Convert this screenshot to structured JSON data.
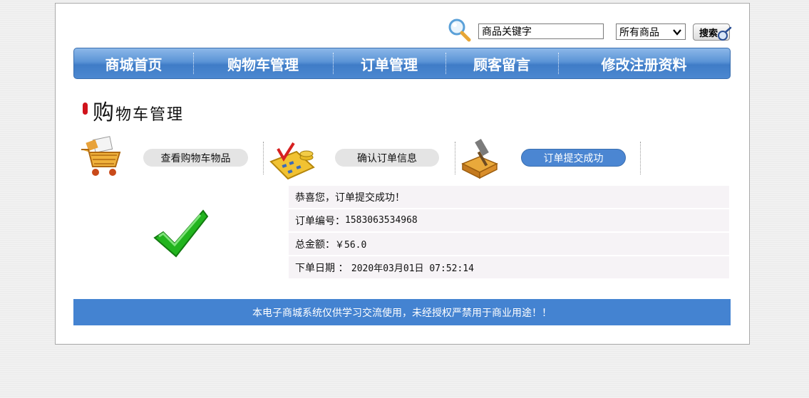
{
  "search": {
    "placeholder": "商品关键字",
    "value": "商品关键字",
    "category_selected": "所有商品",
    "button_label": "搜索"
  },
  "nav": {
    "items": [
      {
        "label": "商城首页"
      },
      {
        "label": "购物车管理"
      },
      {
        "label": "订单管理"
      },
      {
        "label": "顾客留言"
      },
      {
        "label": "修改注册资料"
      }
    ]
  },
  "section": {
    "title_first": "购",
    "title_rest": "物车管理"
  },
  "steps": [
    {
      "label": "查看购物车物品",
      "icon": "shopping-cart-icon",
      "active": false
    },
    {
      "label": "确认订单信息",
      "icon": "calculator-icon",
      "active": false
    },
    {
      "label": "订单提交成功",
      "icon": "package-hammer-icon",
      "active": true
    }
  ],
  "order": {
    "success_message": "恭喜您，订单提交成功！",
    "number_label": "订单编号：",
    "number_value": "1583063534968",
    "total_label": "总金额：",
    "total_value": "￥56.0",
    "date_label": "下单日期 ：",
    "date_value": "2020年03月01日 07:52:14"
  },
  "footer": {
    "text": "本电子商城系统仅供学习交流使用，未经授权严禁用于商业用途！！"
  },
  "colors": {
    "nav_blue": "#4c88d0",
    "footer_blue": "#4483d1",
    "active_step": "#4b86d2",
    "check_green": "#22b41e",
    "row_background": "#f6f3f6"
  }
}
